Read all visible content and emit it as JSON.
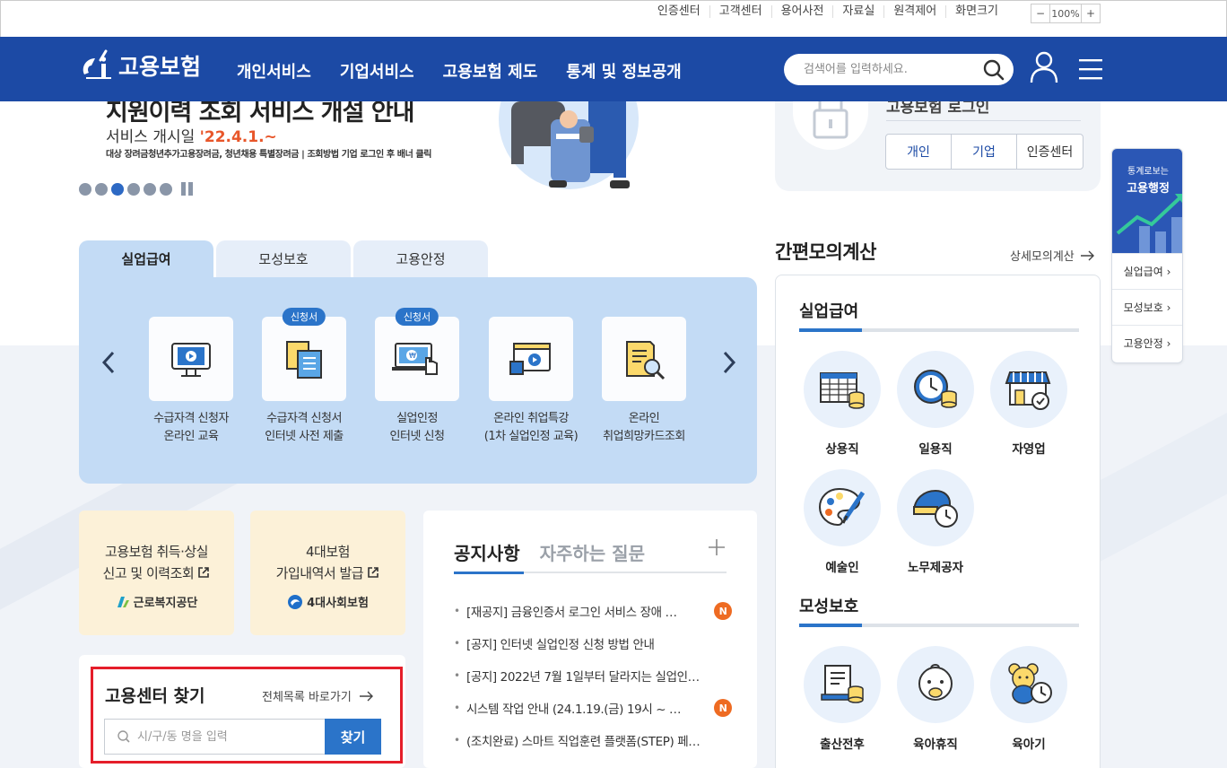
{
  "util": {
    "links": [
      "인증센터",
      "고객센터",
      "용어사전",
      "자료실",
      "원격제어",
      "화면크기"
    ],
    "zoom_minus": "−",
    "zoom_value": "100%",
    "zoom_plus": "+"
  },
  "nav": {
    "logo_text": "고용보험",
    "menu": [
      "개인서비스",
      "기업서비스",
      "고용보험 제도",
      "통계 및 정보공개"
    ],
    "search_placeholder": "검색어를 입력하세요."
  },
  "banner": {
    "title": "지원이력 조회 서비스 개설 안내",
    "date_label": "서비스 개시일",
    "date_value": "'22.4.1.~",
    "desc": "대상 장려금청년추가고용장려금, 청년채용 특별장려금 | 조회방법 기업 로그인 후 배너 클릭",
    "dots": 6,
    "active_dot": 2
  },
  "login": {
    "title": "고용보험 로그인",
    "buttons": [
      "개인",
      "기업",
      "인증센터"
    ]
  },
  "side": {
    "top_small": "통계로보는",
    "top_big": "고용행정",
    "items": [
      "실업급여",
      "모성보호",
      "고용안정"
    ]
  },
  "tabs": [
    "실업급여",
    "모성보호",
    "고용안정"
  ],
  "services": [
    {
      "line1": "수급자격 신청자",
      "line2": "온라인 교육",
      "tag": ""
    },
    {
      "line1": "수급자격 신청서",
      "line2": "인터넷 사전 제출",
      "tag": "신청서"
    },
    {
      "line1": "실업인정",
      "line2": "인터넷 신청",
      "tag": "신청서"
    },
    {
      "line1": "온라인 취업특강",
      "line2": "(1차 실업인정 교육)",
      "tag": ""
    },
    {
      "line1": "온라인",
      "line2": "취업희망카드조회",
      "tag": ""
    }
  ],
  "quick": [
    {
      "line1": "고용보험 취득·상실",
      "line2": "신고 및 이력조회",
      "org": "근로복지공단"
    },
    {
      "line1": "4대보험",
      "line2": "가입내역서 발급",
      "org": "4대사회보험"
    }
  ],
  "notice": {
    "tab1": "공지사항",
    "tab2": "자주하는 질문",
    "items": [
      {
        "text": "[재공지] 금융인증서 로그인 서비스 장애 …",
        "badge": "N"
      },
      {
        "text": "[공지] 인터넷 실업인정 신청 방법 안내",
        "badge": ""
      },
      {
        "text": "[공지] 2022년 7월 1일부터 달라지는 실업인…",
        "badge": ""
      },
      {
        "text": "시스템 작업 안내 (24.1.19.(금) 19시 ~ …",
        "badge": "N"
      },
      {
        "text": "(조치완료) 스마트 직업훈련 플랫폼(STEP) 페…",
        "badge": ""
      }
    ]
  },
  "finder": {
    "title": "고용센터 찾기",
    "link": "전체목록 바로가기",
    "placeholder": "시/구/동 명을 입력",
    "button": "찾기"
  },
  "calc": {
    "title": "간편모의계산",
    "link": "상세모의계산",
    "section1": "실업급여",
    "items1": [
      "상용직",
      "일용직",
      "자영업",
      "예술인",
      "노무제공자"
    ],
    "section2": "모성보호",
    "items2": [
      "출산전후",
      "육아휴직",
      "육아기"
    ]
  },
  "colors": {
    "nav_blue": "#1c4aa5",
    "accent_blue": "#2b74c9",
    "badge_orange": "#ee6b22",
    "highlight_red": "#e51e2a"
  }
}
